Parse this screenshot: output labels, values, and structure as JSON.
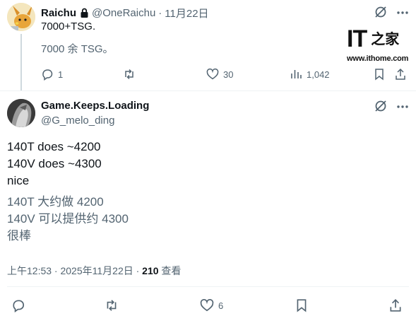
{
  "tweet1": {
    "display_name": "Raichu",
    "handle": "@OneRaichu",
    "separator": "·",
    "date": "11月22日",
    "text": "7000+TSG.",
    "translation": "7000 余 TSG。",
    "replies": "1",
    "likes": "30",
    "views": "1,042"
  },
  "watermark": {
    "mark_latin": "IT",
    "mark_cjk": "之家",
    "url": "www.ithome.com"
  },
  "tweet2": {
    "display_name": "Game.Keeps.Loading",
    "handle": "@G_melo_ding",
    "lines": [
      "140T does ~4200",
      "140V does ~4300",
      "nice"
    ],
    "translation_lines": [
      "140T 大约做 4200",
      "140V 可以提供约 4300",
      "很棒"
    ],
    "timestamp": "上午12:53 · 2025年11月22日 · ",
    "view_count": "210",
    "view_label": " 查看",
    "likes": "6"
  },
  "colors": {
    "text_primary": "#0f1419",
    "text_secondary": "#536471",
    "divider": "#eff3f4",
    "thread_line": "#cfd9de"
  },
  "icons": [
    "lock-icon",
    "grok-icon",
    "more-icon",
    "reply-icon",
    "retweet-icon",
    "like-icon",
    "views-icon",
    "bookmark-icon",
    "share-icon"
  ]
}
